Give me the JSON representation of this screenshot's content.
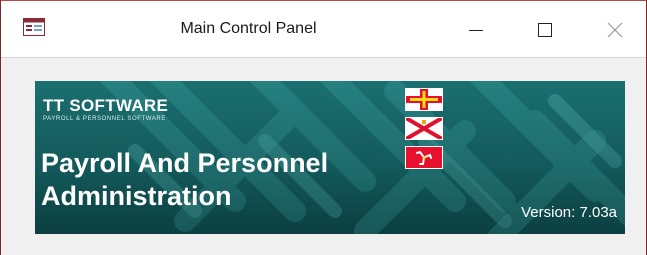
{
  "window": {
    "title": "Main Control Panel",
    "icons": {
      "app": "form-icon",
      "minimize": "minimize-icon",
      "maximize": "maximize-icon",
      "close": "close-icon"
    }
  },
  "banner": {
    "brand": "TT SOFTWARE",
    "brand_tagline": "PAYROLL & PERSONNEL SOFTWARE",
    "app_title": "Payroll And Personnel Administration",
    "version_label": "Version: 7.03a",
    "flags": [
      "guernsey-flag",
      "jersey-flag",
      "isle-of-man-flag"
    ],
    "colors": {
      "background": "#1b6f70",
      "text": "#ffffff"
    }
  }
}
